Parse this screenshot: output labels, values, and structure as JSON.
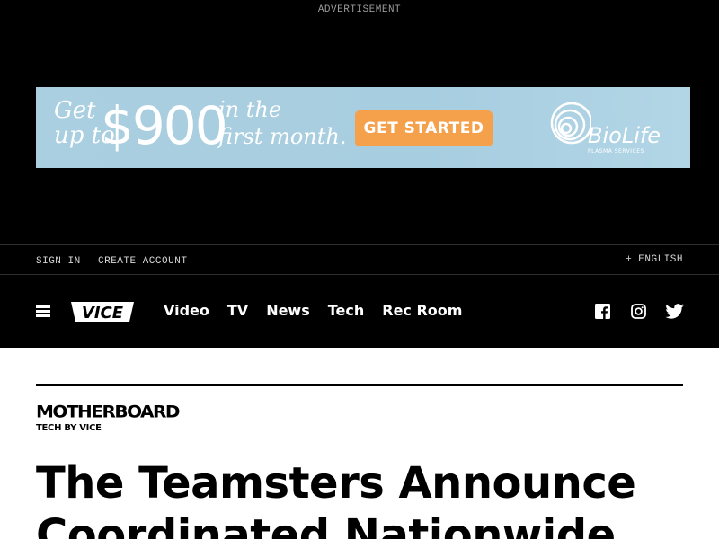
{
  "ad": {
    "label": "ADVERTISEMENT",
    "get_line1": "Get",
    "get_line2": "up to",
    "amount": "$900",
    "first_line1": "in the",
    "first_line2": "first month.",
    "cta": "GET STARTED",
    "brand": "BioLife",
    "brand_sub": "PLASMA SERVICES",
    "bg_color": "#a9cfe0",
    "cta_color": "#f5a04a"
  },
  "account": {
    "sign_in": "SIGN IN",
    "create_account": "CREATE ACCOUNT",
    "language": "+ ENGLISH"
  },
  "nav": {
    "menu_icon": "hamburger-icon",
    "logo_text": "VICE",
    "links": [
      "Video",
      "TV",
      "News",
      "Tech",
      "Rec Room"
    ],
    "social_icons": [
      "facebook-icon",
      "instagram-icon",
      "twitter-icon"
    ]
  },
  "article": {
    "section_logo": "MOTHERBOARD",
    "section_tagline": "TECH BY VICE",
    "headline": "The Teamsters Announce Coordinated Nationwide"
  }
}
